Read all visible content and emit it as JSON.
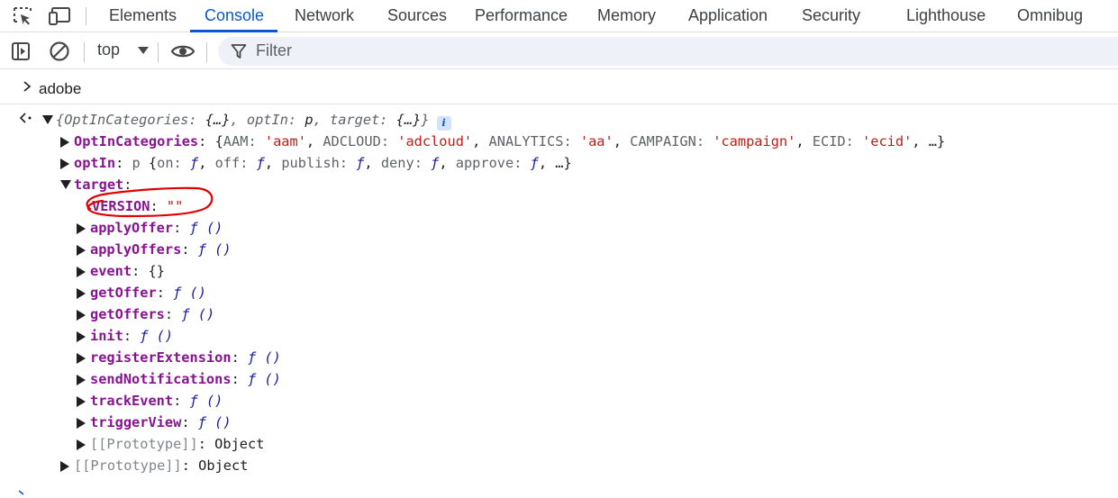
{
  "tabs": [
    {
      "label": "Elements"
    },
    {
      "label": "Console",
      "active": true
    },
    {
      "label": "Network"
    },
    {
      "label": "Sources"
    },
    {
      "label": "Performance"
    },
    {
      "label": "Memory"
    },
    {
      "label": "Application"
    },
    {
      "label": "Security"
    },
    {
      "label": "Lighthouse"
    },
    {
      "label": "Omnibug"
    }
  ],
  "toolbar": {
    "context": "top",
    "filter_placeholder": "Filter"
  },
  "console": {
    "input": "adobe",
    "summary": {
      "open": "{",
      "k1": "OptInCategories",
      "v1": "{…}",
      "k2": "optIn",
      "v2": "p",
      "k3": "target",
      "v3": "{…}",
      "close": "}",
      "badge": "i"
    },
    "optin_categories": {
      "key": "OptInCategories",
      "items": [
        {
          "k": "AAM",
          "v": "'aam'"
        },
        {
          "k": "ADCLOUD",
          "v": "'adcloud'"
        },
        {
          "k": "ANALYTICS",
          "v": "'aa'"
        },
        {
          "k": "CAMPAIGN",
          "v": "'campaign'"
        },
        {
          "k": "ECID",
          "v": "'ecid'"
        }
      ],
      "more": "…}"
    },
    "optin": {
      "key": "optIn",
      "ctor": "p",
      "items": [
        "on",
        "off",
        "publish",
        "deny",
        "approve"
      ],
      "fn": "ƒ",
      "more": "…}"
    },
    "target": {
      "key": "target",
      "version_key": "VERSION",
      "version_value": "\"\"",
      "children": [
        {
          "key": "applyOffer",
          "value": "ƒ ()"
        },
        {
          "key": "applyOffers",
          "value": "ƒ ()"
        },
        {
          "key": "event",
          "value": "{}"
        },
        {
          "key": "getOffer",
          "value": "ƒ ()"
        },
        {
          "key": "getOffers",
          "value": "ƒ ()"
        },
        {
          "key": "init",
          "value": "ƒ ()"
        },
        {
          "key": "registerExtension",
          "value": "ƒ ()"
        },
        {
          "key": "sendNotifications",
          "value": "ƒ ()"
        },
        {
          "key": "trackEvent",
          "value": "ƒ ()"
        },
        {
          "key": "triggerView",
          "value": "ƒ ()"
        }
      ],
      "proto_key": "[[Prototype]]",
      "proto_value": "Object"
    },
    "root_proto_key": "[[Prototype]]",
    "root_proto_value": "Object"
  },
  "colors": {
    "accent": "#0b57d0",
    "property_key": "#881391",
    "string": "#c41a16",
    "function": "#1a1aa6",
    "annotation": "#e00000"
  },
  "icons": [
    "inspect-element-icon",
    "device-toolbar-icon",
    "sidebar-toggle-icon",
    "clear-console-icon",
    "dropdown-caret-icon",
    "eye-icon",
    "filter-icon",
    "prompt-chevron-icon",
    "return-arrow-icon",
    "info-badge-icon"
  ]
}
